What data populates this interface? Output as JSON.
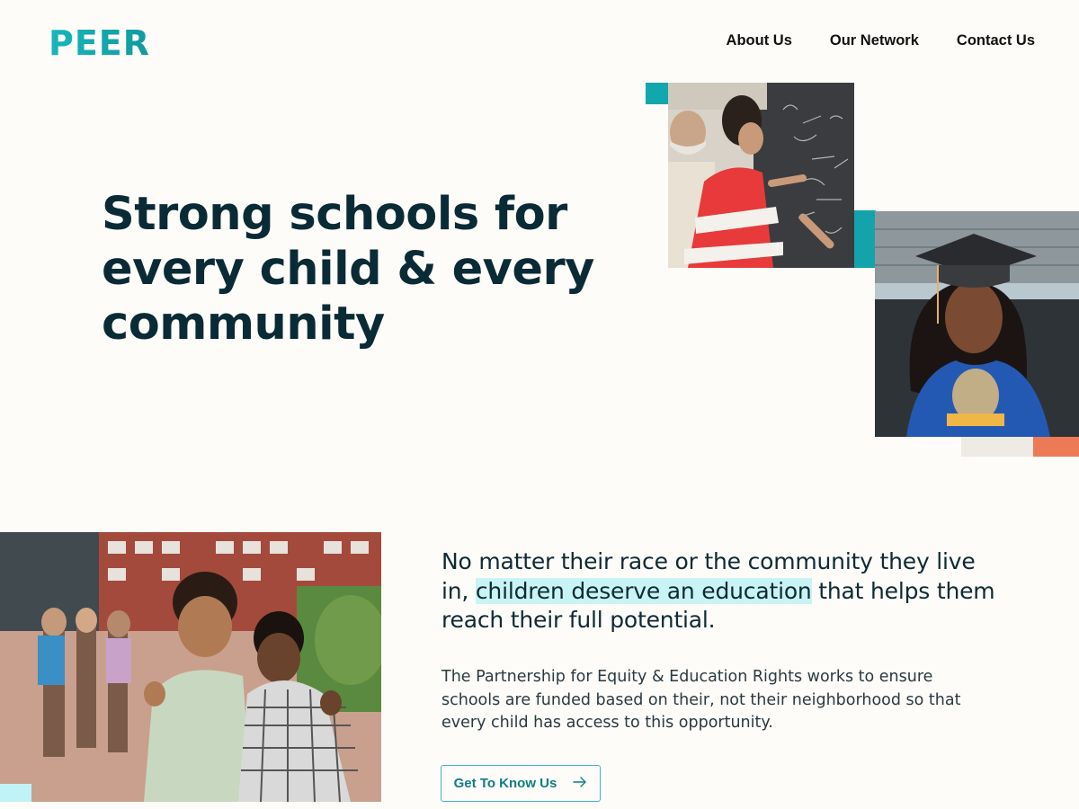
{
  "header": {
    "logo_text": "PEER",
    "nav": [
      {
        "label": "About Us"
      },
      {
        "label": "Our Network"
      },
      {
        "label": "Contact Us"
      }
    ]
  },
  "hero": {
    "title": "Strong schools for every child & every community"
  },
  "mission": {
    "lead_before": "No matter their race or the community they live in, ",
    "lead_highlight": "children deserve an education",
    "lead_after": " that helps them reach their full potential.",
    "body": "The Partnership for Equity & Education Rights works to ensure schools are funded based on their, not their neighborhood so that every child has access to this opportunity.",
    "cta_label": "Get To Know Us",
    "cta_icon": "arrow-right-icon"
  },
  "colors": {
    "brand_teal": "#14b1b5",
    "dark_text": "#0a2b36",
    "accent_orange": "#ec7a57",
    "highlight": "#c9f4f5",
    "background": "#fdfcf9"
  }
}
